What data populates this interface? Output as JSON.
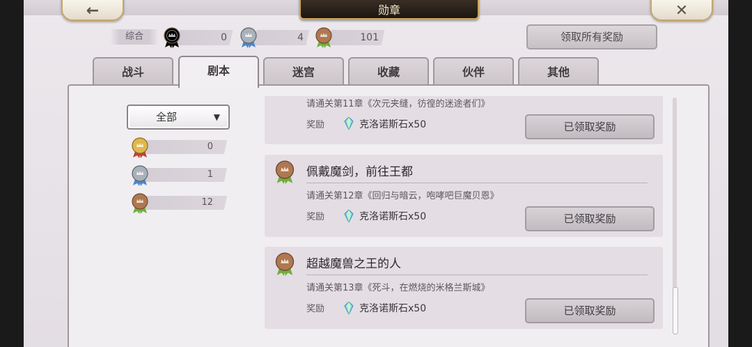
{
  "header": {
    "title": "勋章",
    "back_icon": "←",
    "close_icon": "✕"
  },
  "summary": {
    "label": "综合",
    "gold": "0",
    "silver": "4",
    "bronze": "101",
    "claim_all": "领取所有奖励"
  },
  "tabs": [
    {
      "label": "战斗"
    },
    {
      "label": "剧本"
    },
    {
      "label": "迷宫"
    },
    {
      "label": "收藏"
    },
    {
      "label": "伙伴"
    },
    {
      "label": "其他"
    }
  ],
  "active_tab": "剧本",
  "filter": {
    "selected": "全部",
    "arrow": "▼"
  },
  "counts": {
    "gold": "0",
    "silver": "1",
    "bronze": "12"
  },
  "achievements": [
    {
      "title": "",
      "desc": "请通关第11章《次元夹缝，彷徨的迷途者们》",
      "reward_label": "奖励",
      "reward_item": "克洛诺斯石x50",
      "button": "已领取奖励"
    },
    {
      "title": "佩戴魔剑，前往王都",
      "desc": "请通关第12章《回归与暗云，咆哮吧巨魔贝恩》",
      "reward_label": "奖励",
      "reward_item": "克洛诺斯石x50",
      "button": "已领取奖励"
    },
    {
      "title": "超越魔兽之王的人",
      "desc": "请通关第13章《死斗，在燃烧的米格兰斯城》",
      "reward_label": "奖励",
      "reward_item": "克洛诺斯石x50",
      "button": "已领取奖励"
    }
  ],
  "colors": {
    "gold": "#e0b84a",
    "silver": "#a9b1ba",
    "bronze": "#b07850",
    "ribbon_green": "#6fae3d",
    "ribbon_blue": "#4a86c9",
    "ribbon_red": "#c0403a"
  }
}
